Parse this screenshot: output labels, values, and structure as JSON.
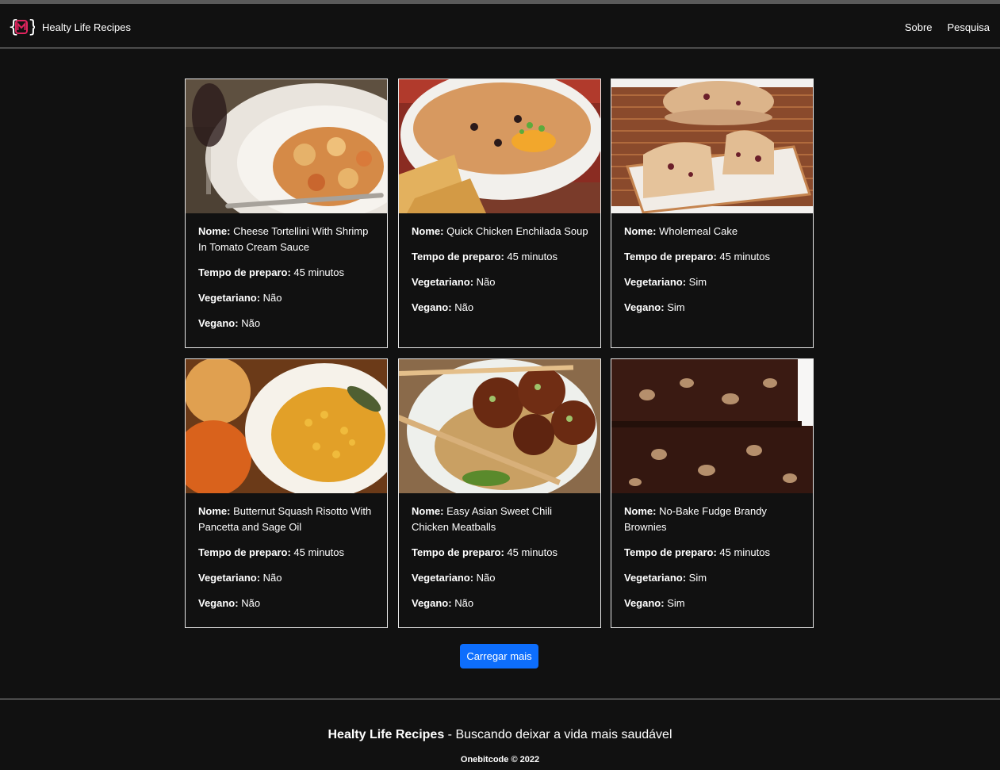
{
  "app": {
    "brand": "Healty Life Recipes",
    "logo_icon": "code-brackets-logo-icon",
    "nav": [
      "Sobre",
      "Pesquisa"
    ]
  },
  "labels": {
    "name": "Nome:",
    "time": "Tempo de preparo:",
    "vegetarian": "Vegetariano:",
    "vegan": "Vegano:"
  },
  "recipes": [
    {
      "name": "Cheese Tortellini With Shrimp In Tomato Cream Sauce",
      "time": "45 minutos",
      "vegetarian": "Não",
      "vegan": "Não"
    },
    {
      "name": "Quick Chicken Enchilada Soup",
      "time": "45 minutos",
      "vegetarian": "Não",
      "vegan": "Não"
    },
    {
      "name": "Wholemeal Cake",
      "time": "45 minutos",
      "vegetarian": "Sim",
      "vegan": "Sim"
    },
    {
      "name": "Butternut Squash Risotto With Pancetta and Sage Oil",
      "time": "45 minutos",
      "vegetarian": "Não",
      "vegan": "Não"
    },
    {
      "name": "Easy Asian Sweet Chili Chicken Meatballs",
      "time": "45 minutos",
      "vegetarian": "Não",
      "vegan": "Não"
    },
    {
      "name": "No-Bake Fudge Brandy Brownies",
      "time": "45 minutos",
      "vegetarian": "Sim",
      "vegan": "Sim"
    }
  ],
  "load_more": "Carregar mais",
  "footer": {
    "brand": "Healty Life Recipes",
    "tagline": "- Buscando deixar a vida mais saudável",
    "copyright": "Onebitcode © 2022"
  },
  "colors": {
    "background": "#111111",
    "button": "#0d6efd",
    "logo_accent": "#e0245e"
  }
}
